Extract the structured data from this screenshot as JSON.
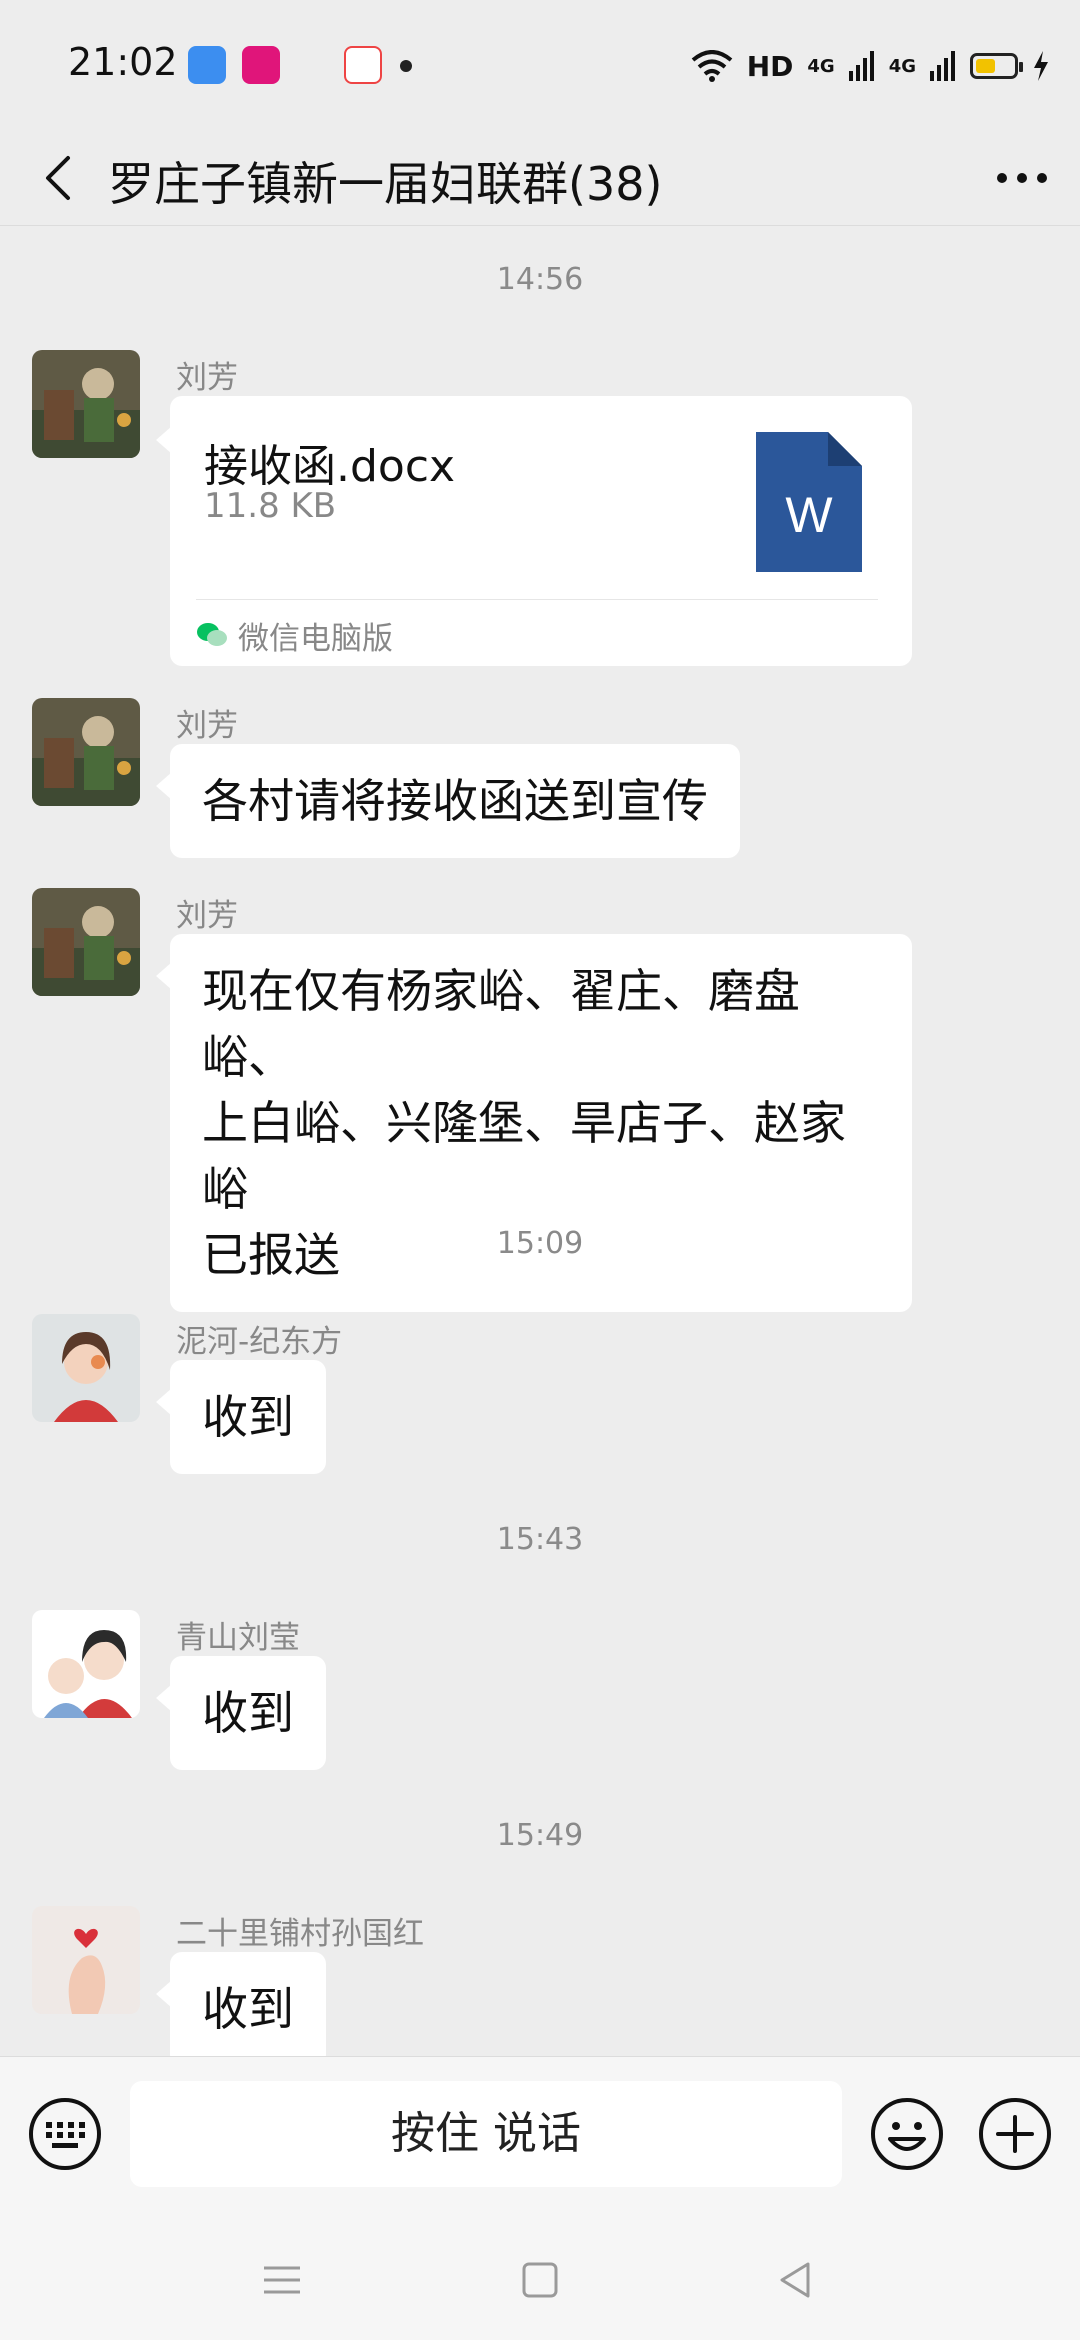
{
  "status_bar": {
    "time": "21:02",
    "network_label": "HD",
    "signal_1": "4G",
    "signal_2": "4G",
    "battery_level": 0.45
  },
  "header": {
    "title": "罗庄子镇新一届妇联群(38)",
    "back_icon": "chevron-left-icon",
    "more_icon": "more-icon"
  },
  "messages": [
    {
      "type": "time",
      "text": "14:56"
    },
    {
      "type": "file",
      "sender": "刘芳",
      "file_name": "接收函.docx",
      "file_size": "11.8 KB",
      "file_type_label": "W",
      "source": "微信电脑版"
    },
    {
      "type": "text",
      "sender": "刘芳",
      "text": "各村请将接收函送到宣传"
    },
    {
      "type": "text",
      "sender": "刘芳",
      "lines": [
        "现在仅有杨家峪、翟庄、磨盘峪、",
        "上白峪、兴隆堡、旱店子、赵家峪",
        "已报送"
      ]
    },
    {
      "type": "time",
      "text": "15:09"
    },
    {
      "type": "text",
      "sender": "泥河-纪东方",
      "text": "收到"
    },
    {
      "type": "time",
      "text": "15:43"
    },
    {
      "type": "text",
      "sender": "青山刘莹",
      "text": "收到"
    },
    {
      "type": "time",
      "text": "15:49"
    },
    {
      "type": "text",
      "sender": "二十里铺村孙国红",
      "text": "收到"
    }
  ],
  "input_bar": {
    "voice_label": "按住 说话"
  },
  "colors": {
    "background": "#ededed",
    "bubble": "#ffffff",
    "word_blue": "#2b579a",
    "wechat_green": "#07c160"
  }
}
